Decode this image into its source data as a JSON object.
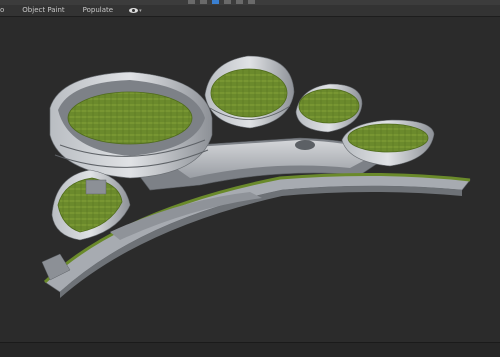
{
  "toolbar": {
    "items": [
      "",
      "",
      "",
      ""
    ]
  },
  "ribbon": {
    "tabs": [
      {
        "label": "o"
      },
      {
        "label": "Object Paint"
      },
      {
        "label": "Populate"
      }
    ]
  },
  "viewport": {
    "content": "architectural-model-render"
  },
  "colors": {
    "background": "#2c2c2c",
    "roof_green": "#6f8f2a",
    "concrete": "#c9ccd0"
  }
}
